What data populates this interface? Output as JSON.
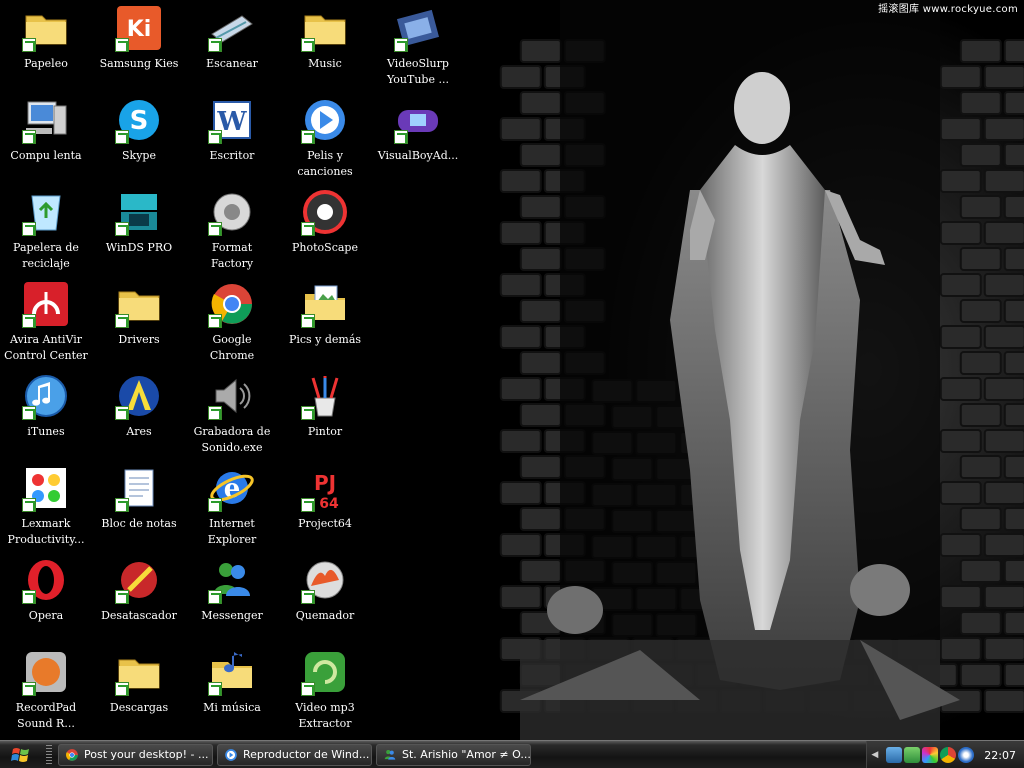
{
  "watermark": "摇滚图库 www.rockyue.com",
  "desktop_icons": [
    {
      "label": "Papeleo",
      "icon": "folder-icon"
    },
    {
      "label": "Samsung Kies",
      "icon": "samsung-kies-icon"
    },
    {
      "label": "Escanear",
      "icon": "scanner-icon"
    },
    {
      "label": "Music",
      "icon": "folder-icon"
    },
    {
      "label": "VideoSlurp\nYouTube ...",
      "icon": "film-icon"
    },
    {
      "label": "Compu lenta",
      "icon": "computer-icon"
    },
    {
      "label": "Skype",
      "icon": "skype-icon"
    },
    {
      "label": "Escritor",
      "icon": "word-icon"
    },
    {
      "label": "Pelis y\ncanciones",
      "icon": "media-player-icon"
    },
    {
      "label": "VisualBoyAd...",
      "icon": "gameboy-icon"
    },
    {
      "label": "Papelera de\nreciclaje",
      "icon": "recycle-bin-icon"
    },
    {
      "label": "WinDS PRO",
      "icon": "nintendo-ds-icon"
    },
    {
      "label": "Format\nFactory",
      "icon": "format-factory-icon"
    },
    {
      "label": "PhotoScape",
      "icon": "photoscape-icon"
    },
    {
      "label": "Avira AntiVir\nControl Center",
      "icon": "avira-icon"
    },
    {
      "label": "Drivers",
      "icon": "folder-icon"
    },
    {
      "label": "Google\nChrome",
      "icon": "chrome-icon"
    },
    {
      "label": "Pics y demás",
      "icon": "picture-folder-icon"
    },
    {
      "label": "iTunes",
      "icon": "itunes-icon"
    },
    {
      "label": "Ares",
      "icon": "ares-icon"
    },
    {
      "label": "Grabadora de\nSonido.exe",
      "icon": "speaker-icon"
    },
    {
      "label": "Pintor",
      "icon": "paint-icon"
    },
    {
      "label": "Lexmark\nProductivity...",
      "icon": "lexmark-icon"
    },
    {
      "label": "Bloc de notas",
      "icon": "notepad-icon"
    },
    {
      "label": "Internet\nExplorer",
      "icon": "internet-explorer-icon"
    },
    {
      "label": "Project64",
      "icon": "project64-icon"
    },
    {
      "label": "Opera",
      "icon": "opera-icon"
    },
    {
      "label": "Desatascador",
      "icon": "cleaner-icon"
    },
    {
      "label": "Messenger",
      "icon": "messenger-icon"
    },
    {
      "label": "Quemador",
      "icon": "burner-icon"
    },
    {
      "label": "RecordPad\nSound R...",
      "icon": "recordpad-icon"
    },
    {
      "label": "Descargas",
      "icon": "folder-icon"
    },
    {
      "label": "Mi música",
      "icon": "music-folder-icon"
    },
    {
      "label": "Video mp3\nExtractor",
      "icon": "video-mp3-icon"
    }
  ],
  "taskbar": {
    "start_icon": "windows-logo-icon",
    "tasks": [
      {
        "label": "Post your desktop! - ...",
        "icon": "chrome-icon"
      },
      {
        "label": "Reproductor de Wind...",
        "icon": "media-player-icon"
      },
      {
        "label": "St. Arishio \"Amor ≠ O...",
        "icon": "messenger-icon"
      }
    ],
    "clock": "22:07"
  },
  "colors": {
    "taskbar": "#1a1a1a",
    "label_text": "#ffffff",
    "desktop_bg": "#000000"
  }
}
